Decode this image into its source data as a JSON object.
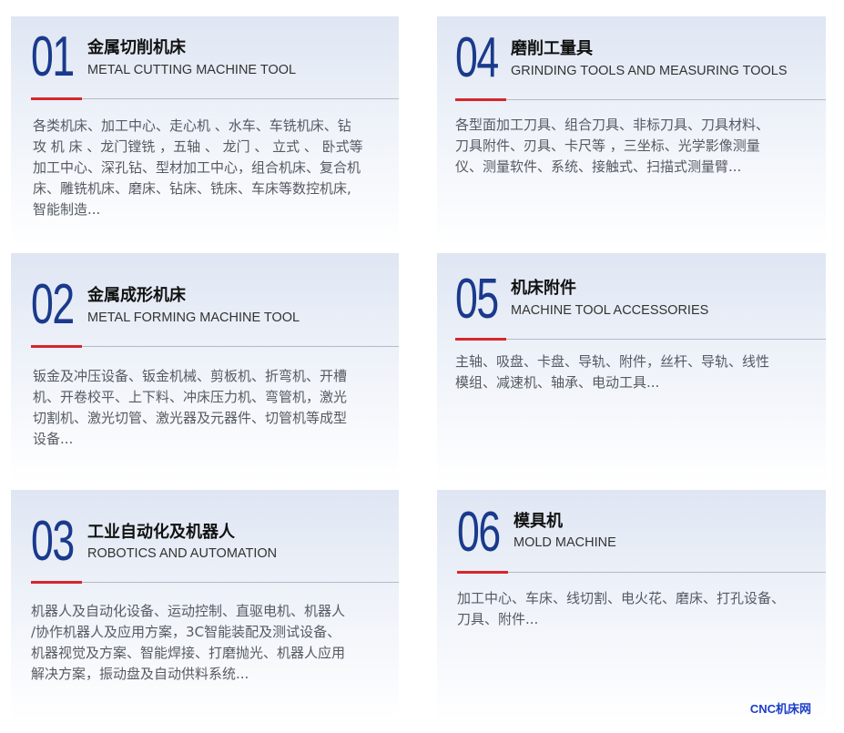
{
  "cards": [
    {
      "number": "01",
      "title_cn": "金属切削机床",
      "title_en": "METAL CUTTING MACHINE TOOL",
      "desc_lines": [
        "各类机床、加工中心、走心机 、水车、车铣机床、钻",
        "攻 机 床 、龙门镗铣 ，五轴 、 龙门 、 立式 、 卧式等",
        "加工中心、深孔钻、型材加工中心，组合机床、复合机",
        "床、雕铣机床、磨床、钻床、铣床、车床等数控机床,",
        "智能制造..."
      ]
    },
    {
      "number": "04",
      "title_cn": "磨削工量具",
      "title_en": "GRINDING TOOLS AND MEASURING TOOLS",
      "desc_lines": [
        "各型面加工刀具、组合刀具、非标刀具、刀具材料、",
        "刀具附件、刃具、卡尺等 ，三坐标、光学影像测量",
        "仪、测量软件、系统、接触式、扫描式测量臂..."
      ]
    },
    {
      "number": "02",
      "title_cn": "金属成形机床",
      "title_en": "METAL FORMING MACHINE TOOL",
      "desc_lines": [
        "钣金及冲压设备、钣金机械、剪板机、折弯机、开槽",
        "机、开卷校平、上下料、冲床压力机、弯管机，激光",
        "切割机、激光切管、激光器及元器件、切管机等成型",
        "设备..."
      ]
    },
    {
      "number": "05",
      "title_cn": "机床附件",
      "title_en": "MACHINE TOOL ACCESSORIES",
      "desc_lines": [
        "主轴、吸盘、卡盘、导轨、附件，丝杆、导轨、线性",
        "模组、减速机、轴承、电动工具..."
      ]
    },
    {
      "number": "03",
      "title_cn": "工业自动化及机器人",
      "title_en": "ROBOTICS AND AUTOMATION",
      "desc_lines": [
        "机器人及自动化设备、运动控制、直驱电机、机器人",
        "/协作机器人及应用方案，3C智能装配及测试设备、",
        "机器视觉及方案、智能焊接、打磨抛光、机器人应用",
        "解决方案，振动盘及自动供料系统..."
      ]
    },
    {
      "number": "06",
      "title_cn": "模具机",
      "title_en": "MOLD MACHINE",
      "desc_lines": [
        "加工中心、车床、线切割、电火花、磨床、打孔设备、",
        "刀具、附件..."
      ]
    }
  ],
  "watermark": "CNC机床网",
  "colors": {
    "number": "#1a3a8c",
    "accent_red": "#d7262c",
    "watermark": "#1a3ec8"
  }
}
